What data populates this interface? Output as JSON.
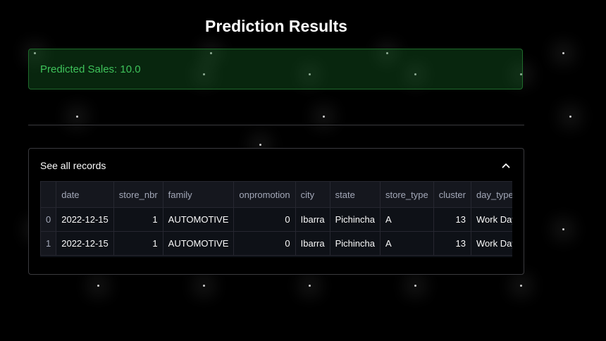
{
  "page": {
    "title": "Prediction Results"
  },
  "alert": {
    "text": "Predicted Sales: 10.0",
    "color": "#3ec15a"
  },
  "expander": {
    "title": "See all records",
    "icon": "chevron-up-icon",
    "expanded": true
  },
  "table": {
    "columns": [
      "",
      "date",
      "store_nbr",
      "family",
      "onpromotion",
      "city",
      "state",
      "store_type",
      "cluster",
      "day_type"
    ],
    "rows": [
      {
        "index": "0",
        "date": "2022-12-15",
        "store_nbr": "1",
        "family": "AUTOMOTIVE",
        "onpromotion": "0",
        "city": "Ibarra",
        "state": "Pichincha",
        "store_type": "A",
        "cluster": "13",
        "day_type": "Work Day"
      },
      {
        "index": "1",
        "date": "2022-12-15",
        "store_nbr": "1",
        "family": "AUTOMOTIVE",
        "onpromotion": "0",
        "city": "Ibarra",
        "state": "Pichincha",
        "store_type": "A",
        "cluster": "13",
        "day_type": "Work Day"
      }
    ]
  }
}
